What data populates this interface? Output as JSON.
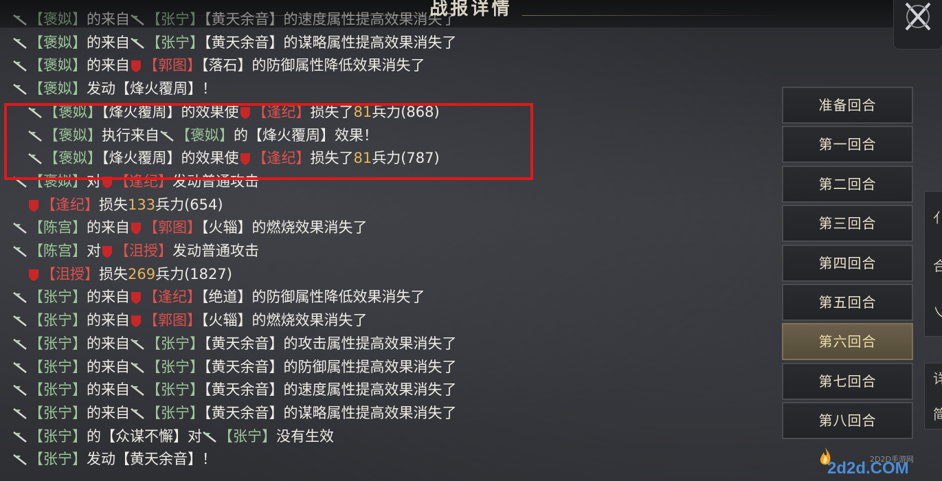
{
  "header": {
    "title": "战报详情",
    "close_icon": "crossed-swords-close-icon"
  },
  "icons": {
    "ally": "green-flag-icon",
    "enemy": "red-shield-icon"
  },
  "colors": {
    "ally": "#9cc79a",
    "enemy": "#e0524c",
    "number": "#e6b65a",
    "highlight": "#e0191b",
    "active_round": "#6a604a"
  },
  "log": [
    {
      "faded": true,
      "parts": [
        {
          "t": "flag"
        },
        {
          "t": "g",
          "v": "【褒姒】"
        },
        {
          "t": "w",
          "v": "的来自"
        },
        {
          "t": "flag"
        },
        {
          "t": "g",
          "v": "【张宁】"
        },
        {
          "t": "w",
          "v": "【黄天余音】的速度属性提高效果消失了"
        }
      ]
    },
    {
      "parts": [
        {
          "t": "flag"
        },
        {
          "t": "g",
          "v": "【褒姒】"
        },
        {
          "t": "w",
          "v": "的来自"
        },
        {
          "t": "flag"
        },
        {
          "t": "g",
          "v": "【张宁】"
        },
        {
          "t": "w",
          "v": "【黄天余音】的谋略属性提高效果消失了"
        }
      ]
    },
    {
      "parts": [
        {
          "t": "flag"
        },
        {
          "t": "g",
          "v": "【褒姒】"
        },
        {
          "t": "w",
          "v": "的来自"
        },
        {
          "t": "shield"
        },
        {
          "t": "r",
          "v": "【郭图】"
        },
        {
          "t": "w",
          "v": "【落石】的防御属性降低效果消失了"
        }
      ]
    },
    {
      "parts": [
        {
          "t": "flag"
        },
        {
          "t": "g",
          "v": "【褒姒】"
        },
        {
          "t": "w",
          "v": "发动【烽火覆周】！"
        }
      ]
    },
    {
      "indent": true,
      "parts": [
        {
          "t": "flag"
        },
        {
          "t": "g",
          "v": "【褒姒】"
        },
        {
          "t": "w",
          "v": "【烽火覆周】的效果使"
        },
        {
          "t": "shield"
        },
        {
          "t": "r",
          "v": "【逢纪】"
        },
        {
          "t": "w",
          "v": "损失了"
        },
        {
          "t": "n",
          "v": "81"
        },
        {
          "t": "w",
          "v": "兵力(868)"
        }
      ]
    },
    {
      "indent": true,
      "parts": [
        {
          "t": "flag"
        },
        {
          "t": "g",
          "v": "【褒姒】"
        },
        {
          "t": "w",
          "v": "执行来自"
        },
        {
          "t": "flag"
        },
        {
          "t": "g",
          "v": "【褒姒】"
        },
        {
          "t": "w",
          "v": "的【烽火覆周】效果！"
        }
      ]
    },
    {
      "indent": true,
      "parts": [
        {
          "t": "flag"
        },
        {
          "t": "g",
          "v": "【褒姒】"
        },
        {
          "t": "w",
          "v": "【烽火覆周】的效果使"
        },
        {
          "t": "shield"
        },
        {
          "t": "r",
          "v": "【逢纪】"
        },
        {
          "t": "w",
          "v": "损失了"
        },
        {
          "t": "n",
          "v": "81"
        },
        {
          "t": "w",
          "v": "兵力(787)"
        }
      ]
    },
    {
      "parts": [
        {
          "t": "flag"
        },
        {
          "t": "g",
          "v": "【褒姒】"
        },
        {
          "t": "w",
          "v": "对"
        },
        {
          "t": "shield"
        },
        {
          "t": "r",
          "v": "【逢纪】"
        },
        {
          "t": "w",
          "v": "发动普通攻击"
        }
      ]
    },
    {
      "indent": true,
      "parts": [
        {
          "t": "shield"
        },
        {
          "t": "r",
          "v": "【逢纪】"
        },
        {
          "t": "w",
          "v": "损失"
        },
        {
          "t": "n",
          "v": "133"
        },
        {
          "t": "w",
          "v": "兵力(654)"
        }
      ]
    },
    {
      "parts": [
        {
          "t": "flag"
        },
        {
          "t": "g",
          "v": "【陈宫】"
        },
        {
          "t": "w",
          "v": "的来自"
        },
        {
          "t": "shield"
        },
        {
          "t": "r",
          "v": "【郭图】"
        },
        {
          "t": "w",
          "v": "【火辎】的燃烧效果消失了"
        }
      ]
    },
    {
      "parts": [
        {
          "t": "flag"
        },
        {
          "t": "g",
          "v": "【陈宫】"
        },
        {
          "t": "w",
          "v": "对"
        },
        {
          "t": "shield"
        },
        {
          "t": "r",
          "v": "【沮授】"
        },
        {
          "t": "w",
          "v": "发动普通攻击"
        }
      ]
    },
    {
      "indent": true,
      "parts": [
        {
          "t": "shield"
        },
        {
          "t": "r",
          "v": "【沮授】"
        },
        {
          "t": "w",
          "v": "损失"
        },
        {
          "t": "n",
          "v": "269"
        },
        {
          "t": "w",
          "v": "兵力(1827)"
        }
      ]
    },
    {
      "parts": [
        {
          "t": "flag"
        },
        {
          "t": "g",
          "v": "【张宁】"
        },
        {
          "t": "w",
          "v": "的来自"
        },
        {
          "t": "shield"
        },
        {
          "t": "r",
          "v": "【逢纪】"
        },
        {
          "t": "w",
          "v": "【绝道】的防御属性降低效果消失了"
        }
      ]
    },
    {
      "parts": [
        {
          "t": "flag"
        },
        {
          "t": "g",
          "v": "【张宁】"
        },
        {
          "t": "w",
          "v": "的来自"
        },
        {
          "t": "shield"
        },
        {
          "t": "r",
          "v": "【郭图】"
        },
        {
          "t": "w",
          "v": "【火辎】的燃烧效果消失了"
        }
      ]
    },
    {
      "parts": [
        {
          "t": "flag"
        },
        {
          "t": "g",
          "v": "【张宁】"
        },
        {
          "t": "w",
          "v": "的来自"
        },
        {
          "t": "flag"
        },
        {
          "t": "g",
          "v": "【张宁】"
        },
        {
          "t": "w",
          "v": "【黄天余音】的攻击属性提高效果消失了"
        }
      ]
    },
    {
      "parts": [
        {
          "t": "flag"
        },
        {
          "t": "g",
          "v": "【张宁】"
        },
        {
          "t": "w",
          "v": "的来自"
        },
        {
          "t": "flag"
        },
        {
          "t": "g",
          "v": "【张宁】"
        },
        {
          "t": "w",
          "v": "【黄天余音】的防御属性提高效果消失了"
        }
      ]
    },
    {
      "parts": [
        {
          "t": "flag"
        },
        {
          "t": "g",
          "v": "【张宁】"
        },
        {
          "t": "w",
          "v": "的来自"
        },
        {
          "t": "flag"
        },
        {
          "t": "g",
          "v": "【张宁】"
        },
        {
          "t": "w",
          "v": "【黄天余音】的速度属性提高效果消失了"
        }
      ]
    },
    {
      "parts": [
        {
          "t": "flag"
        },
        {
          "t": "g",
          "v": "【张宁】"
        },
        {
          "t": "w",
          "v": "的来自"
        },
        {
          "t": "flag"
        },
        {
          "t": "g",
          "v": "【张宁】"
        },
        {
          "t": "w",
          "v": "【黄天余音】的谋略属性提高效果消失了"
        }
      ]
    },
    {
      "parts": [
        {
          "t": "flag"
        },
        {
          "t": "g",
          "v": "【张宁】"
        },
        {
          "t": "w",
          "v": "的【众谋不懈】对"
        },
        {
          "t": "flag"
        },
        {
          "t": "g",
          "v": "【张宁】"
        },
        {
          "t": "w",
          "v": "没有生效"
        }
      ]
    },
    {
      "parts": [
        {
          "t": "flag"
        },
        {
          "t": "g",
          "v": "【张宁】"
        },
        {
          "t": "w",
          "v": "发动【黄天余音】！"
        }
      ]
    }
  ],
  "rounds": [
    {
      "label": "准备回合",
      "active": false
    },
    {
      "label": "第一回合",
      "active": false
    },
    {
      "label": "第二回合",
      "active": false
    },
    {
      "label": "第三回合",
      "active": false
    },
    {
      "label": "第四回合",
      "active": false
    },
    {
      "label": "第五回合",
      "active": false
    },
    {
      "label": "第六回合",
      "active": true
    },
    {
      "label": "第七回合",
      "active": false
    },
    {
      "label": "第八回合",
      "active": false
    }
  ],
  "edge": {
    "glyphs": [
      "亻",
      "合",
      "乀"
    ],
    "glyphs2": [
      "详",
      "简"
    ]
  },
  "watermark": {
    "main": "2d2d.COM",
    "small": "2D2D手游网"
  }
}
